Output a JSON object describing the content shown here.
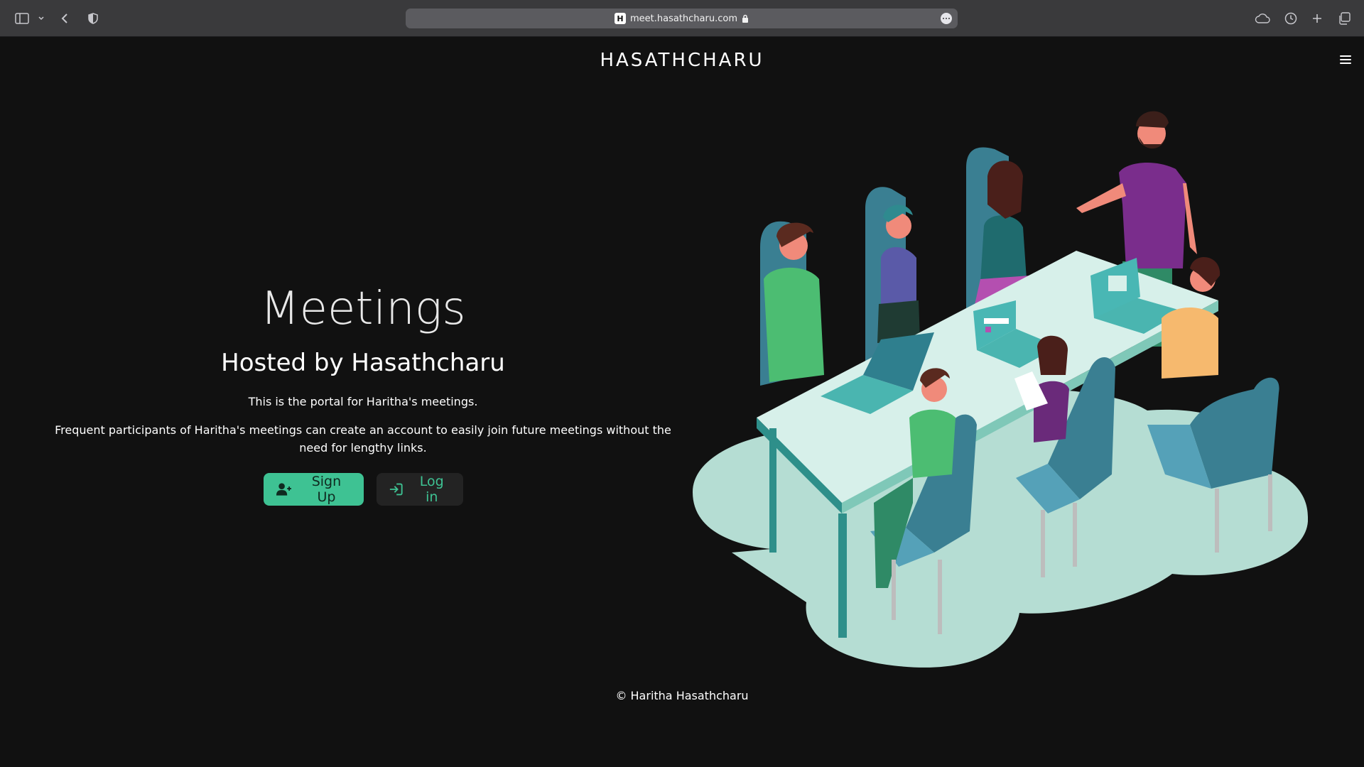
{
  "browser": {
    "url": "meet.hasathcharu.com",
    "favicon_letter": "H"
  },
  "header": {
    "logo": "HASATHCHARU"
  },
  "hero": {
    "title": "Meetings",
    "subtitle": "Hosted by Hasathcharu",
    "intro": "This is the portal for Haritha's meetings.",
    "description": "Frequent participants of Haritha's meetings can create an account to easily join future meetings without the need for lengthy links.",
    "signup_label": "Sign Up",
    "login_label": "Log in"
  },
  "footer": {
    "copyright": "© Haritha Hasathcharu"
  },
  "colors": {
    "accent": "#3ec293",
    "background": "#111111",
    "button_dark": "#232323"
  }
}
